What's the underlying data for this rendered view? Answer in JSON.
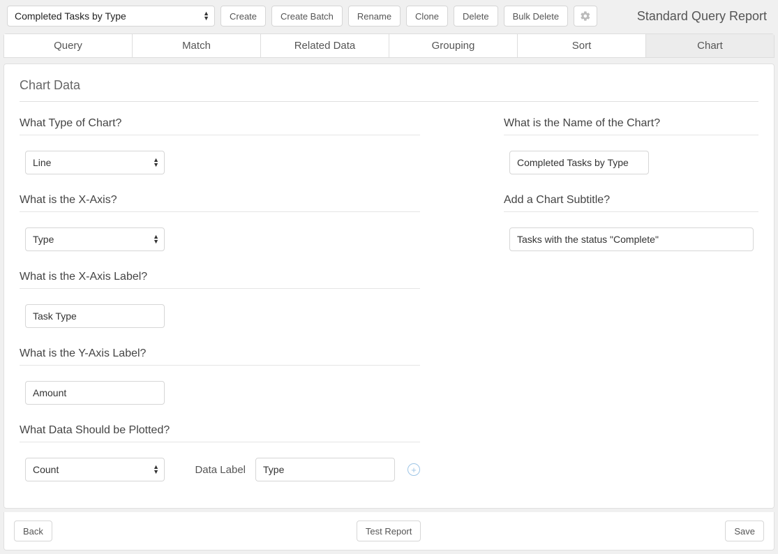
{
  "topbar": {
    "report_selected": "Completed Tasks by Type",
    "create": "Create",
    "create_batch": "Create Batch",
    "rename": "Rename",
    "clone": "Clone",
    "delete": "Delete",
    "bulk_delete": "Bulk Delete",
    "gear_icon": "gear-icon",
    "title": "Standard Query Report"
  },
  "tabs": {
    "items": [
      "Query",
      "Match",
      "Related Data",
      "Grouping",
      "Sort",
      "Chart"
    ],
    "active_index": 5
  },
  "panel": {
    "title": "Chart Data"
  },
  "left": {
    "chart_type": {
      "label": "What Type of Chart?",
      "value": "Line"
    },
    "x_axis": {
      "label": "What is the X-Axis?",
      "value": "Type"
    },
    "x_axis_label": {
      "label": "What is the X-Axis Label?",
      "value": "Task Type"
    },
    "y_axis_label": {
      "label": "What is the Y-Axis Label?",
      "value": "Amount"
    },
    "plot": {
      "label": "What Data Should be Plotted?",
      "agg_value": "Count",
      "data_label_caption": "Data Label",
      "data_label_value": "Type"
    }
  },
  "right": {
    "chart_name": {
      "label": "What is the Name of the Chart?",
      "value": "Completed Tasks by Type"
    },
    "chart_subtitle": {
      "label": "Add a Chart Subtitle?",
      "value": "Tasks with the status \"Complete\""
    }
  },
  "footer": {
    "back": "Back",
    "test_report": "Test Report",
    "save": "Save"
  }
}
